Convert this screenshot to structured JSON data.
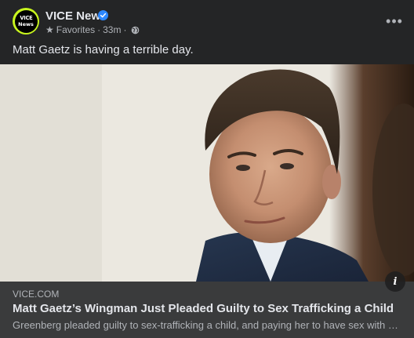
{
  "page": {
    "name": "VICE News",
    "avatar_top": "VICE",
    "avatar_bottom": "News",
    "favorites_label": "Favorites",
    "time_ago": "33m",
    "separator": "·"
  },
  "post": {
    "text": "Matt Gaetz is having a terrible day."
  },
  "link": {
    "domain": "VICE.COM",
    "title": "Matt Gaetz’s Wingman Just Pleaded Guilty to Sex Trafficking a Child",
    "description": "Greenberg pleaded guilty to sex-trafficking a child, and paying her to have sex with Gaetz, according to his plea agreement."
  },
  "icons": {
    "verified": "verified-badge-icon",
    "favorites": "star-icon",
    "audience": "globe-icon",
    "more": "more-options-icon",
    "info": "info-icon"
  },
  "colors": {
    "background": "#242526",
    "footer": "#3a3b3c",
    "primary_text": "#e4e6eb",
    "secondary_text": "#b0b3b8",
    "verified_blue": "#2d88ff",
    "vice_lime": "#c8f51e"
  }
}
